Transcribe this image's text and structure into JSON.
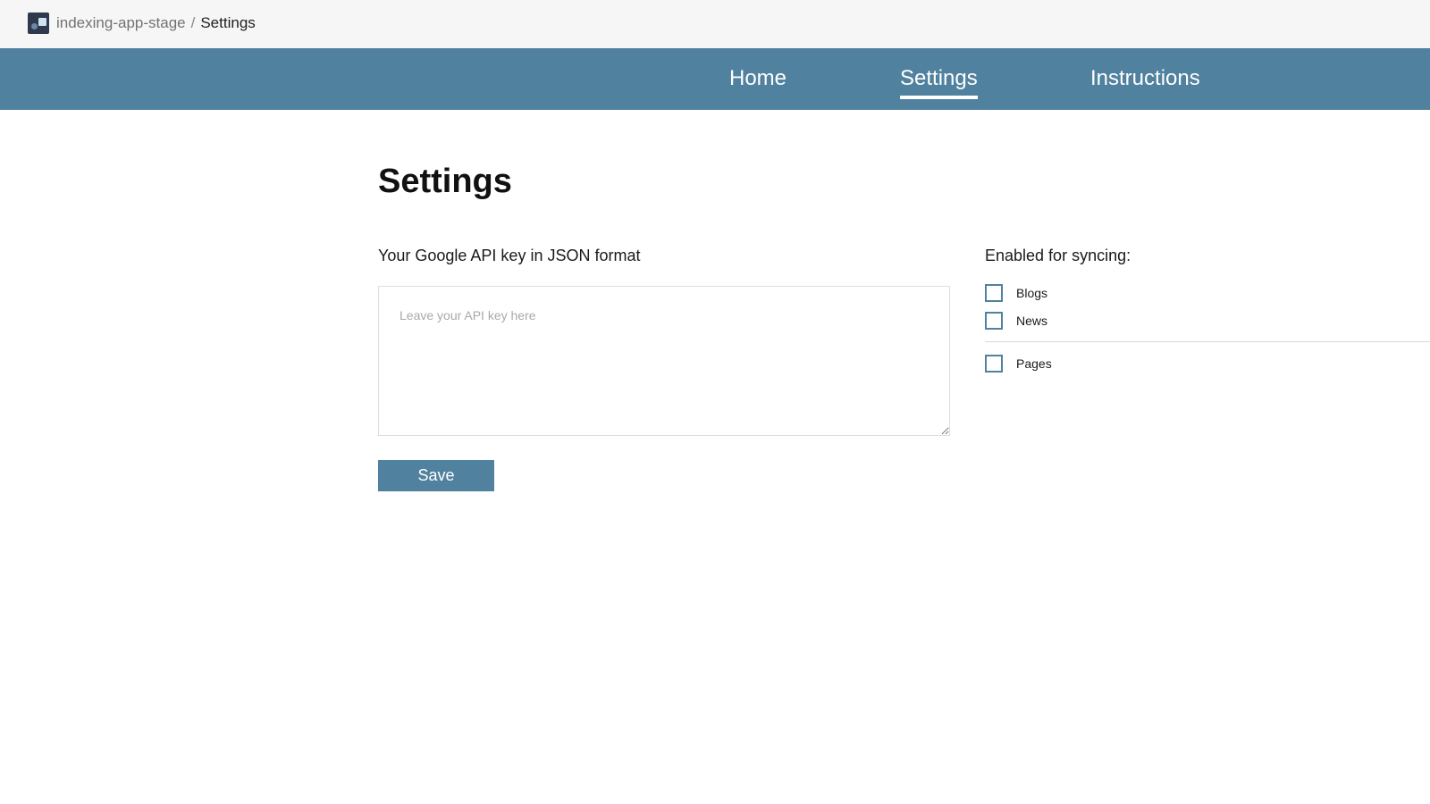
{
  "topbar": {
    "app_icon": "app-logo-icon",
    "breadcrumb": {
      "app_name": "indexing-app-stage",
      "separator": "/",
      "current": "Settings"
    }
  },
  "nav": {
    "items": [
      {
        "label": "Home",
        "active": false
      },
      {
        "label": "Settings",
        "active": true
      },
      {
        "label": "Instructions",
        "active": false
      }
    ],
    "background_color": "#50819e"
  },
  "main": {
    "title": "Settings",
    "api_key": {
      "label": "Your Google API key in JSON format",
      "placeholder": "Leave your API key here",
      "value": ""
    },
    "save_label": "Save",
    "sync": {
      "label": "Enabled for syncing:",
      "options": [
        {
          "label": "Blogs",
          "checked": false
        },
        {
          "label": "News",
          "checked": false
        },
        {
          "label": "Pages",
          "checked": false
        }
      ]
    }
  },
  "colors": {
    "accent": "#50819e",
    "topbar_bg": "#f6f6f6"
  }
}
